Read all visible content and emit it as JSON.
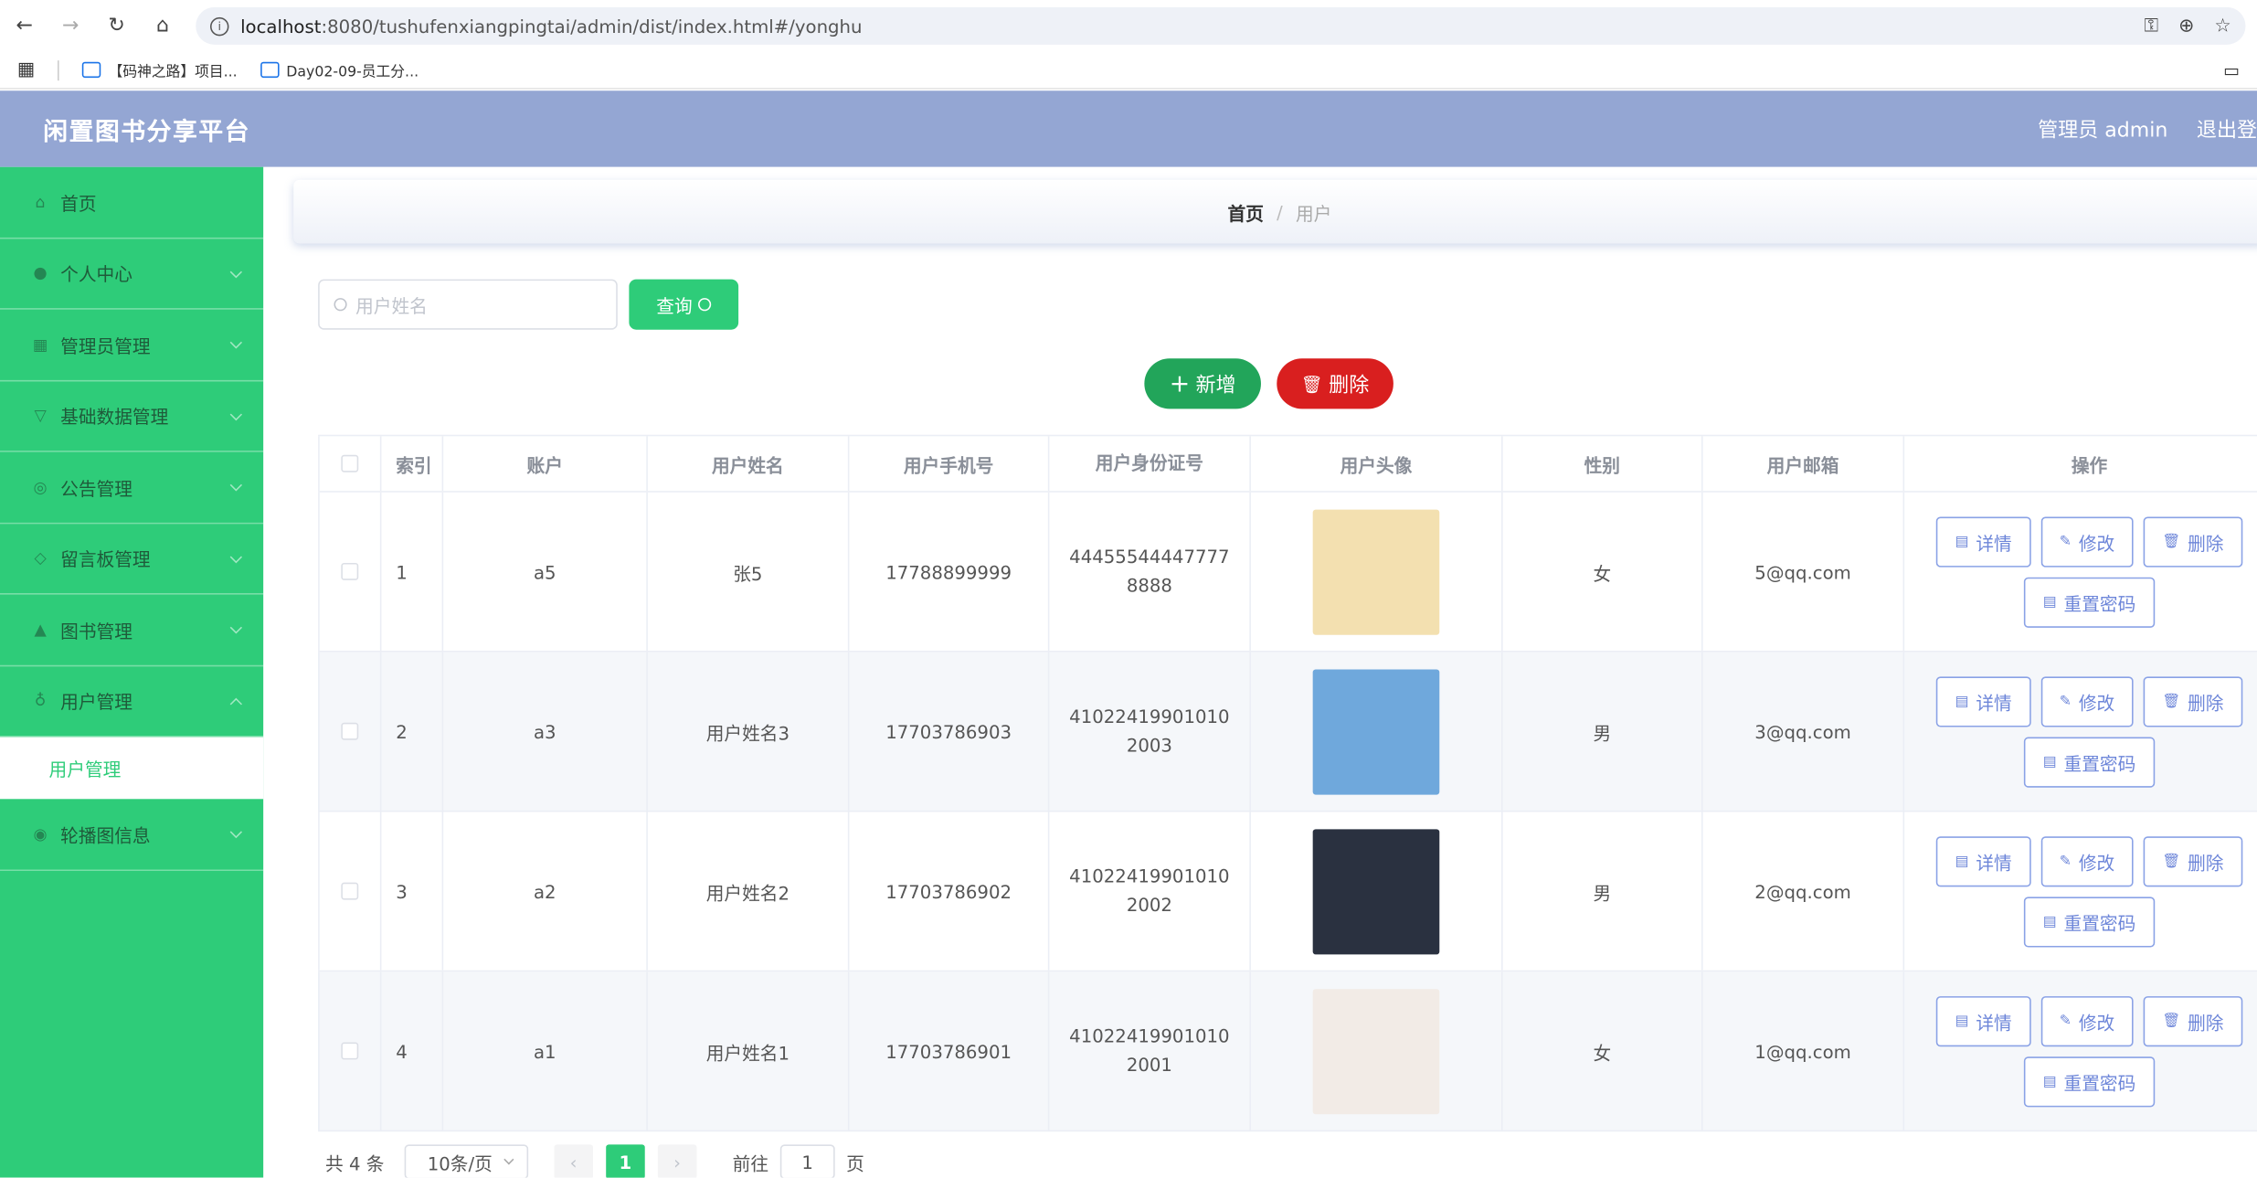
{
  "browser": {
    "url_host": "localhost",
    "url_rest": ":8080/tushufenxiangpingtai/admin/dist/index.html#/yonghu",
    "bookmarks": [
      {
        "label": "【码神之路】项目..."
      },
      {
        "label": "Day02-09-员工分..."
      }
    ]
  },
  "header": {
    "title": "闲置图书分享平台",
    "user": "管理员 admin",
    "logout": "退出登"
  },
  "sidebar": {
    "items": [
      {
        "label": "首页",
        "icon": "home-icon"
      },
      {
        "label": "个人中心",
        "icon": "user-icon"
      },
      {
        "label": "管理员管理",
        "icon": "grid-icon"
      },
      {
        "label": "基础数据管理",
        "icon": "filter-icon"
      },
      {
        "label": "公告管理",
        "icon": "notice-icon"
      },
      {
        "label": "留言板管理",
        "icon": "message-icon"
      },
      {
        "label": "图书管理",
        "icon": "book-icon"
      },
      {
        "label": "用户管理",
        "icon": "mic-icon"
      },
      {
        "label": "轮播图信息",
        "icon": "image-icon"
      }
    ],
    "submenu_active": "用户管理"
  },
  "breadcrumb": {
    "home": "首页",
    "sep": "/",
    "current": "用户"
  },
  "search": {
    "placeholder": "用户姓名",
    "button": "查询"
  },
  "actions": {
    "add": "新增",
    "delete": "删除"
  },
  "table": {
    "headers": [
      "索引",
      "账户",
      "用户姓名",
      "用户手机号",
      "用户身份证号",
      "用户头像",
      "性别",
      "用户邮箱",
      "操作"
    ],
    "rows": [
      {
        "index": "1",
        "account": "a5",
        "name": "张5",
        "phone": "17788899999",
        "id_card": "444555444477778888",
        "gender": "女",
        "email": "5@qq.com",
        "avatar_color": "#f3e0b0"
      },
      {
        "index": "2",
        "account": "a3",
        "name": "用户姓名3",
        "phone": "17703786903",
        "id_card": "410224199010102003",
        "gender": "男",
        "email": "3@qq.com",
        "avatar_color": "#6fa8dc"
      },
      {
        "index": "3",
        "account": "a2",
        "name": "用户姓名2",
        "phone": "17703786902",
        "id_card": "410224199010102002",
        "gender": "男",
        "email": "2@qq.com",
        "avatar_color": "#2a3140"
      },
      {
        "index": "4",
        "account": "a1",
        "name": "用户姓名1",
        "phone": "17703786901",
        "id_card": "410224199010102001",
        "gender": "女",
        "email": "1@qq.com",
        "avatar_color": "#f2ebe6"
      }
    ],
    "ops": {
      "detail": "详情",
      "edit": "修改",
      "delete": "删除",
      "reset": "重置密码"
    }
  },
  "pager": {
    "total": "共 4 条",
    "size": "10条/页",
    "current": "1",
    "goto": "前往",
    "page_value": "1",
    "page_suffix": "页"
  },
  "colors": {
    "sidebar": "#2ecc79",
    "header": "#94a6d3",
    "add": "#22a55a",
    "danger": "#d91f1f",
    "op_border": "#8aa2e6"
  }
}
